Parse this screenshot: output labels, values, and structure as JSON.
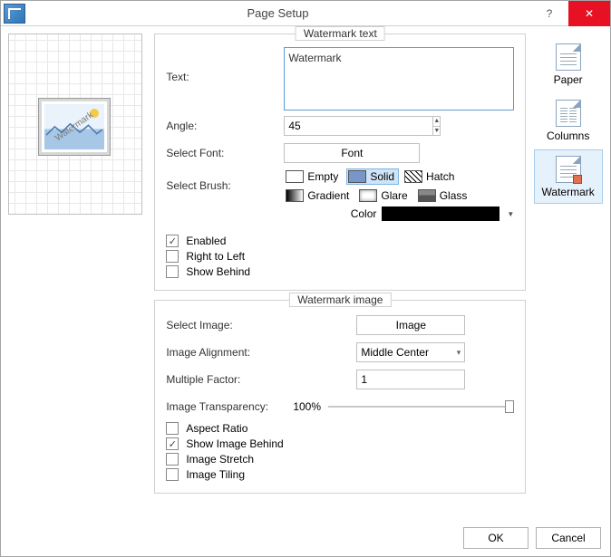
{
  "window": {
    "title": "Page Setup",
    "help": "?",
    "close": "✕"
  },
  "sidebar": {
    "items": [
      {
        "label": "Paper"
      },
      {
        "label": "Columns"
      },
      {
        "label": "Watermark"
      }
    ],
    "selected": 2
  },
  "preview": {
    "watermark_text": "Watermark"
  },
  "watermark_text": {
    "legend": "Watermark text",
    "text_label": "Text:",
    "text_value": "Watermark",
    "angle_label": "Angle:",
    "angle_value": "45",
    "select_font_label": "Select Font:",
    "font_button": "Font",
    "select_brush_label": "Select Brush:",
    "brushes": {
      "empty": "Empty",
      "solid": "Solid",
      "hatch": "Hatch",
      "gradient": "Gradient",
      "glare": "Glare",
      "glass": "Glass"
    },
    "color_label": "Color",
    "color_value": "#000000",
    "enabled_label": "Enabled",
    "enabled": true,
    "rtl_label": "Right to Left",
    "rtl": false,
    "show_behind_label": "Show Behind",
    "show_behind": false
  },
  "watermark_image": {
    "legend": "Watermark image",
    "select_image_label": "Select Image:",
    "image_button": "Image",
    "alignment_label": "Image Alignment:",
    "alignment_value": "Middle Center",
    "multiple_label": "Multiple Factor:",
    "multiple_value": "1",
    "transparency_label": "Image Transparency:",
    "transparency_value": "100%",
    "aspect_label": "Aspect Ratio",
    "aspect": false,
    "behind_label": "Show Image Behind",
    "behind": true,
    "stretch_label": "Image Stretch",
    "stretch": false,
    "tiling_label": "Image Tiling",
    "tiling": false
  },
  "footer": {
    "ok": "OK",
    "cancel": "Cancel"
  }
}
